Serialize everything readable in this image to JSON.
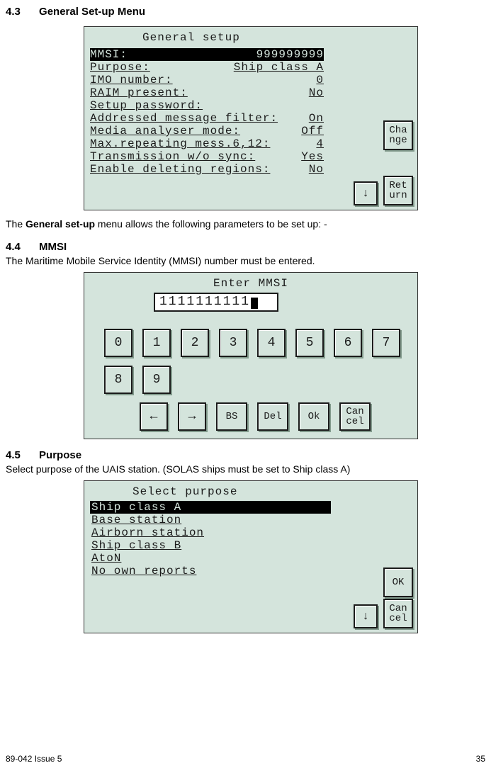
{
  "sections": {
    "s43": {
      "num": "4.3",
      "title": "General Set-up Menu"
    },
    "s44": {
      "num": "4.4",
      "title": "MMSI"
    },
    "s45": {
      "num": "4.5",
      "title": "Purpose"
    }
  },
  "para1_pre": "The ",
  "para1_bold": "General set-up",
  "para1_post": " menu allows the following parameters to be set up: -",
  "para2": "The Maritime Mobile Service Identity (MMSI) number must be entered.",
  "para3": "Select purpose of the UAIS station. (SOLAS ships must be set to Ship class A)",
  "screen1": {
    "title": "General setup",
    "rows": [
      {
        "label": "MMSI:",
        "value": "999999999",
        "selected": true,
        "underline": true
      },
      {
        "label": "Purpose:",
        "value": "Ship class A",
        "underline": true
      },
      {
        "label": "IMO number:",
        "value": "0",
        "underline": true
      },
      {
        "label": "RAIM present:",
        "value": "No",
        "underline": true
      },
      {
        "label": "Setup password:",
        "value": "",
        "underline": true
      },
      {
        "label": "Addressed message filter:",
        "value": "On",
        "underline": true
      },
      {
        "label": "Media analyser mode:",
        "value": "Off",
        "underline": true
      },
      {
        "label": "Max.repeating mess.6,12:",
        "value": "4",
        "underline": true
      },
      {
        "label": "Transmission w/o sync:",
        "value": "Yes",
        "underline": true
      },
      {
        "label": "Enable deleting regions:",
        "value": "No",
        "underline": true
      }
    ],
    "buttons": {
      "change": "Cha\nnge",
      "return": "Ret\nurn",
      "down": "↓"
    }
  },
  "screen2": {
    "title": "Enter MMSI",
    "input_value": "1111111111",
    "keys_row1": [
      "0",
      "1",
      "2",
      "3",
      "4",
      "5",
      "6",
      "7"
    ],
    "keys_row2": [
      "8",
      "9"
    ],
    "ctrl_keys": {
      "left": "←",
      "right": "→",
      "bs": "BS",
      "del": "Del",
      "ok": "Ok",
      "cancel": "Can\ncel"
    }
  },
  "screen3": {
    "title": "Select purpose",
    "items": [
      {
        "label": "Ship class A",
        "selected": true
      },
      {
        "label": "Base station"
      },
      {
        "label": "Airborn station"
      },
      {
        "label": "Ship class B"
      },
      {
        "label": "AtoN"
      },
      {
        "label": "No own reports"
      }
    ],
    "buttons": {
      "ok": "OK",
      "cancel": "Can\ncel",
      "down": "↓"
    }
  },
  "footer": {
    "left": "89-042 Issue 5",
    "right": "35"
  }
}
